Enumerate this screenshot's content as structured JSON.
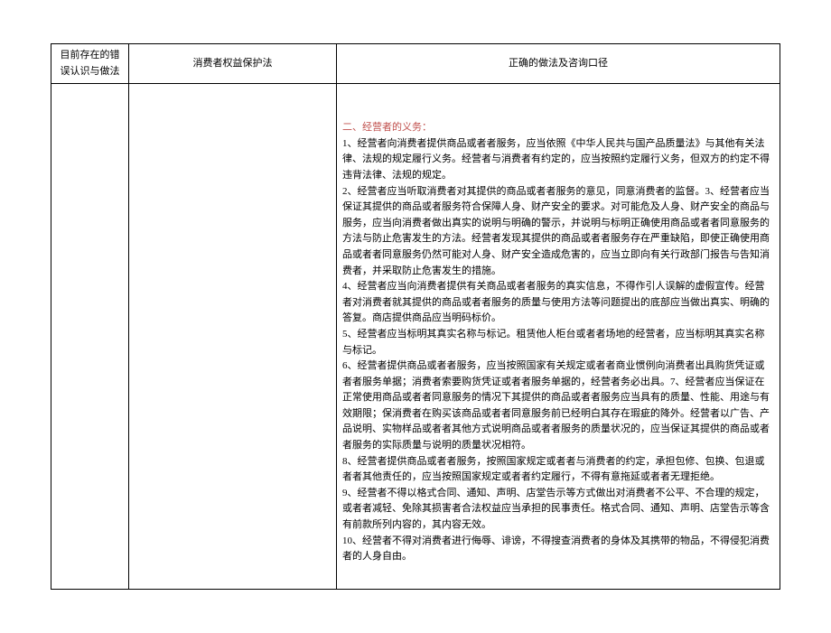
{
  "headers": {
    "col1": "目前存在的错误认识与做法",
    "col2": "消费者权益保护法",
    "col3": "正确的做法及咨询口径"
  },
  "section": {
    "title": "二、经营者的义务：",
    "items": {
      "p1": "1、经营者向消费者提供商品或者者服务，应当依照《中华人民共与国产品质量法》与其他有关法律、法规的规定履行义务。经营者与消费者有约定的，应当按照约定履行义务，但双方的约定不得违背法律、法规的规定。",
      "p2": "2、经营者应当听取消费者对其提供的商品或者者服务的意见，同意消费者的监督。3、经营者应当保证其提供的商品或者服务符合保障人身、财产安全的要求。对可能危及人身、财产安全的商品与服务，应当向消费者做出真实的说明与明确的警示，并说明与标明正确使用商品或者者同意服务的方法与防止危害发生的方法。经营者发现其提供的商品或者者服务存在严重缺陷，即使正确使用商品或者者同意服务仍然可能对人身、财产安全造成危害的，应当立即向有关行政部门报告与告知消费者，并采取防止危害发生的措施。",
      "p3": "4、经营者应当向消费者提供有关商品或者者服务的真实信息，不得作引人误解的虚假宣传。经营者对消费者就其提供的商品或者者服务的质量与使用方法等问题提出的底部应当做出真实、明确的答复。商店提供商品应当明码标价。",
      "p4": "5、经营者应当标明其真实名称与标记。租赁他人柜台或者者场地的经营者，应当标明其真实名称与标记。",
      "p5": "6、经营者提供商品或者者服务，应当按照国家有关规定或者者商业惯例向消费者出具购货凭证或者者服务单据；消费者索要购货凭证或者者服务单据的，经营者务必出具。7、经营者应当保证在正常使用商品或者者同意服务的情况下其提供的商品或者者服务应当具有的质量、性能、用途与有效期限；保消费者在购买该商品或者者同意服务前已经明白其存在瑕疵的降外。经营者以广告、产品说明、实物样品或者者其他方式说明商品或者者服务的质量状况的，应当保证其提供的商品或者者服务的实际质量与说明的质量状况相符。",
      "p6": "8、经营者提供商品或者者服务，按照国家规定或者者与消费者的约定，承担包修、包换、包退或者者其他责任的，应当按照国家规定或者者约定履行，不得有意拖延或者者无理拒绝。",
      "p7": "9、经营者不得以格式合同、通知、声明、店堂告示等方式做出对消费者不公平、不合理的规定，或者者减轻、免除其损害者合法权益应当承担的民事责任。格式合同、通知、声明、店堂告示等含有前款所列内容的，其内容无效。",
      "p8": "10、经营者不得对消费者进行侮辱、诽谤，不得搜查消费者的身体及其携带的物品，不得侵犯消费者的人身自由。"
    }
  }
}
